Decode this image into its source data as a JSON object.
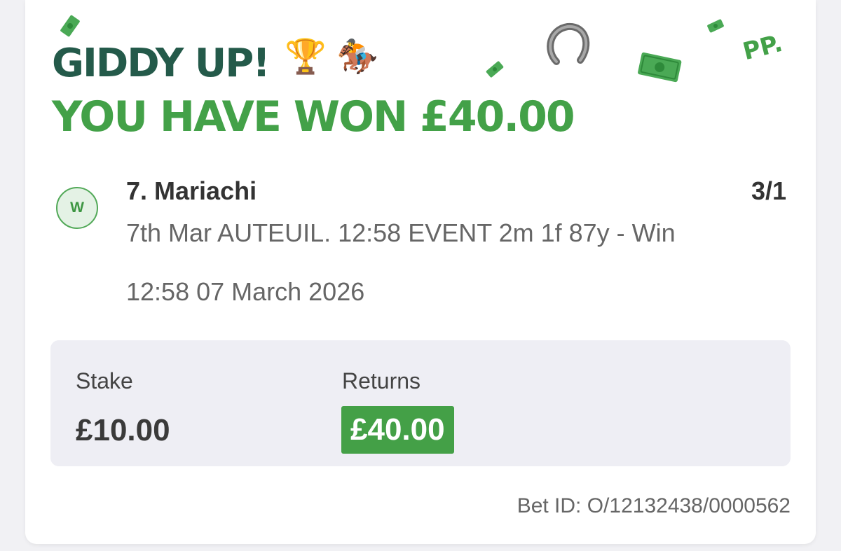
{
  "header": {
    "line1": "GIDDY UP!",
    "line2": "YOU HAVE WON £40.00",
    "trophy_emoji": "🏆",
    "horse_emoji": "🏇",
    "brand_mark": "PP."
  },
  "bet": {
    "result_badge": "W",
    "selection": "7. Mariachi",
    "odds": "3/1",
    "event": "7th Mar AUTEUIL. 12:58 EVENT 2m 1f 87y - Win",
    "datetime": "12:58 07 March 2026"
  },
  "summary": {
    "stake_label": "Stake",
    "stake_value": "£10.00",
    "returns_label": "Returns",
    "returns_value": "£40.00"
  },
  "footer": {
    "bet_id": "Bet ID: O/12132438/0000562"
  },
  "decorations": [
    "money-note-icon",
    "horseshoe-icon"
  ],
  "colors": {
    "brand_dark_green": "#245a4a",
    "brand_green": "#43a148",
    "panel_bg": "#eeeef4"
  }
}
